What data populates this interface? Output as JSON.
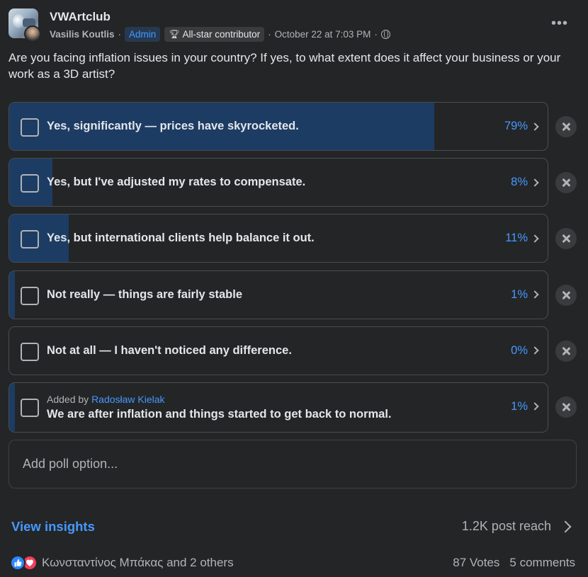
{
  "header": {
    "group_name": "VWArtclub",
    "author": "Vasilis Koutlis",
    "admin_badge": "Admin",
    "contributor_badge": "All-star contributor",
    "timestamp": "October 22 at 7:03 PM",
    "separator": "·"
  },
  "question": "Are you facing inflation issues in your country? If yes, to what extent does it affect your business or your work as a 3D artist?",
  "poll": {
    "options": [
      {
        "label": "Yes, significantly — prices have skyrocketed.",
        "percent": "79%",
        "fill": 0.79
      },
      {
        "label": "Yes, but I've adjusted my rates to compensate.",
        "percent": "8%",
        "fill": 0.08
      },
      {
        "label": "Yes, but international clients help balance it out.",
        "percent": "11%",
        "fill": 0.11
      },
      {
        "label": "Not really — things are fairly stable",
        "percent": "1%",
        "fill": 0.01
      },
      {
        "label": "Not at all — I haven't noticed any difference.",
        "percent": "0%",
        "fill": 0.0
      },
      {
        "label": "We are after inflation and things started to get back to normal.",
        "percent": "1%",
        "fill": 0.01,
        "added_by_prefix": "Added by",
        "added_by_name": "Radosław Kielak"
      }
    ],
    "add_option_placeholder": "Add poll option..."
  },
  "insights": {
    "label": "View insights",
    "reach": "1.2K post reach"
  },
  "footer": {
    "reactors": "Κωνσταντίνος Μπάκας and 2 others",
    "votes": "87 Votes",
    "comments": "5 comments"
  },
  "colors": {
    "background": "#242526",
    "bar_fill": "#1c3c63",
    "accent": "#4599ff",
    "like": "#2d88ff",
    "love": "#f33e58"
  }
}
